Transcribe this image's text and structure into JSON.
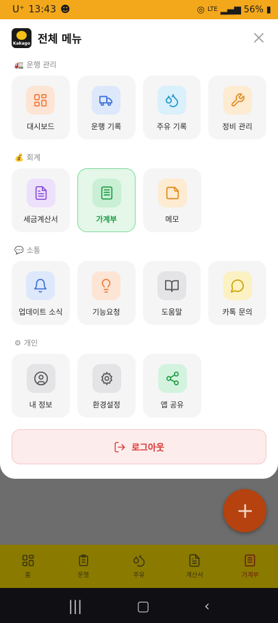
{
  "status_bar": {
    "carrier": "U⁺",
    "time": "13:43",
    "network": "LTE",
    "battery": "56%"
  },
  "header": {
    "logo_text": "Kakago",
    "title": "전체 메뉴",
    "close_label": "×"
  },
  "sections": [
    {
      "icon": "🚛",
      "title": "운행 관리",
      "items": [
        {
          "label": "대시보드",
          "icon": "dashboard-icon",
          "color": "#f07a3c",
          "bg": "#fde5d6"
        },
        {
          "label": "운행 기록",
          "icon": "truck-icon",
          "color": "#3b6fd8",
          "bg": "#dde8fb"
        },
        {
          "label": "주유 기록",
          "icon": "droplets-icon",
          "color": "#2196c9",
          "bg": "#daf0fb"
        },
        {
          "label": "정비 관리",
          "icon": "wrench-icon",
          "color": "#e08a1e",
          "bg": "#fdebd2"
        }
      ]
    },
    {
      "icon": "💰",
      "title": "회계",
      "items": [
        {
          "label": "세금계산서",
          "icon": "document-icon",
          "color": "#8a4fd6",
          "bg": "#ece0fb"
        },
        {
          "label": "가계부",
          "icon": "ledger-icon",
          "color": "#1f9c45",
          "bg": "#c9efd5",
          "active": true
        },
        {
          "label": "메모",
          "icon": "memo-icon",
          "color": "#e08a1e",
          "bg": "#fdebd2"
        }
      ]
    },
    {
      "icon": "💬",
      "title": "소통",
      "items": [
        {
          "label": "업데이트 소식",
          "icon": "bell-icon",
          "color": "#3b6fd8",
          "bg": "#dde8fb"
        },
        {
          "label": "기능요청",
          "icon": "lightbulb-icon",
          "color": "#f07a3c",
          "bg": "#fde5d6"
        },
        {
          "label": "도움말",
          "icon": "book-icon",
          "color": "#555555",
          "bg": "#e4e4e6"
        },
        {
          "label": "카톡 문의",
          "icon": "chat-icon",
          "color": "#c9a000",
          "bg": "#fcf1c2"
        }
      ]
    },
    {
      "icon": "⚙",
      "title": "개인",
      "items": [
        {
          "label": "내 정보",
          "icon": "user-icon",
          "color": "#555555",
          "bg": "#e4e4e6"
        },
        {
          "label": "환경설정",
          "icon": "settings-icon",
          "color": "#555555",
          "bg": "#e4e4e6"
        },
        {
          "label": "앱 공유",
          "icon": "share-icon",
          "color": "#1f9c45",
          "bg": "#d4f3de"
        }
      ]
    }
  ],
  "logout_label": "로그아웃",
  "bottom_nav": [
    {
      "label": "홈",
      "icon": "dashboard-icon"
    },
    {
      "label": "운행",
      "icon": "clipboard-icon"
    },
    {
      "label": "주유",
      "icon": "droplets-icon"
    },
    {
      "label": "계산서",
      "icon": "document-icon"
    },
    {
      "label": "가계부",
      "icon": "ledger-icon",
      "active": true
    }
  ],
  "fab_label": "+"
}
